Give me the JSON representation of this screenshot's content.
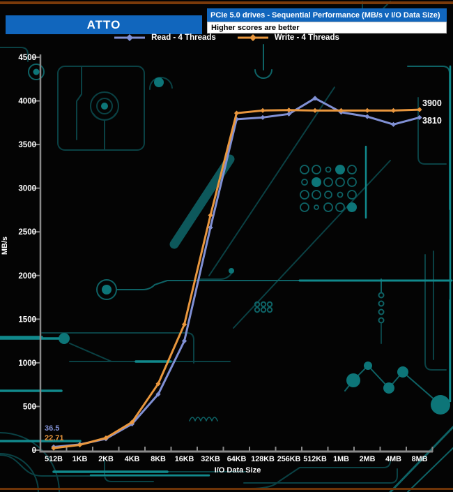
{
  "header": {
    "brand": "ATTO",
    "title": "PCIe 5.0 drives - Sequential Performance (MB/s v I/O Data Size)",
    "subtitle": "Higher scores are better"
  },
  "legend": [
    {
      "label": "Read - 4 Threads",
      "color": "#8090d4"
    },
    {
      "label": "Write - 4 Threads",
      "color": "#e9973e"
    }
  ],
  "colors": {
    "header_blue": "#1166bd",
    "axis_gray": "#8a8a8a",
    "read_line": "#8090d4",
    "write_line": "#e9973e",
    "top_border": "#7a3a0a",
    "circuit_teal": "#0e6265"
  },
  "chart_data": {
    "type": "line",
    "title": "PCIe 5.0 drives - Sequential Performance (MB/s v I/O Data Size)",
    "xlabel": "I/O Data Size",
    "ylabel": "MB/s",
    "ylim": [
      0,
      4500
    ],
    "ytick_step": 500,
    "grid": false,
    "legend_position": "top",
    "categories": [
      "512B",
      "1KB",
      "2KB",
      "4KB",
      "8KB",
      "16KB",
      "32KB",
      "64KB",
      "128KB",
      "256KB",
      "512KB",
      "1MB",
      "2MB",
      "4MB",
      "8MB"
    ],
    "series": [
      {
        "name": "Read - 4 Threads",
        "color": "#8090d4",
        "values": [
          36.5,
          65,
          130,
          300,
          640,
          1250,
          2550,
          3790,
          3810,
          3850,
          4030,
          3870,
          3820,
          3730,
          3810
        ]
      },
      {
        "name": "Write - 4 Threads",
        "color": "#e9973e",
        "values": [
          22.71,
          60,
          140,
          320,
          760,
          1440,
          2690,
          3860,
          3890,
          3895,
          3890,
          3890,
          3890,
          3890,
          3900
        ]
      }
    ],
    "annotations": {
      "start_labels": [
        {
          "series": 0,
          "text": "36.5"
        },
        {
          "series": 1,
          "text": "22.71"
        }
      ],
      "end_labels": [
        {
          "series": 1,
          "text": "3900"
        },
        {
          "series": 0,
          "text": "3810"
        }
      ]
    }
  }
}
